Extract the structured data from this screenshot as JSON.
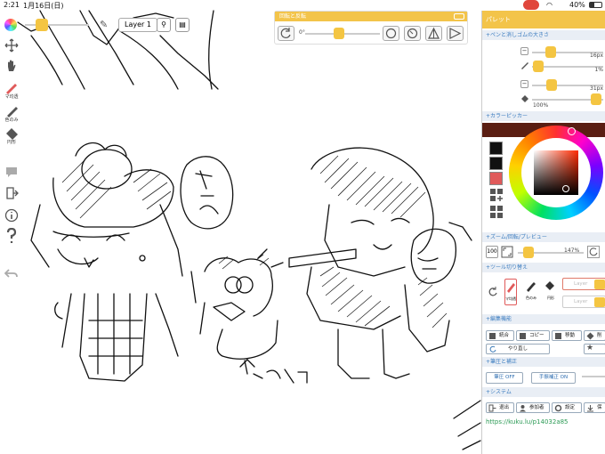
{
  "status": {
    "time": "2:21",
    "date": "1月16日(日)",
    "battery": "40%"
  },
  "layer": {
    "name": "Layer 1"
  },
  "left_toolbar": {
    "tools": [
      {
        "label": "マ均透"
      },
      {
        "label": "色のみ"
      },
      {
        "label": "円形"
      }
    ]
  },
  "rotate_panel": {
    "title": "回転と反転",
    "angle": "0°"
  },
  "palette": {
    "title": "パレット",
    "pen_size_section": "+ペンと消しゴムの大きさ",
    "pen_size_value": "16px",
    "pen_opacity_value": "1%",
    "eraser_size_value": "31px",
    "eraser_opacity_value": "100%",
    "color_picker_section": "+カラーピッカー",
    "zoom_section": "+ズーム/回転/プレビュー",
    "zoom_value": "100",
    "zoom_percent": "147%",
    "tool_switch_section": "+ツール切り替え",
    "tool_labels": [
      "マ均透",
      "色のみ",
      "円形"
    ],
    "layer_placeholder_1": "Layer",
    "layer_placeholder_2": "Layer",
    "edit_section": "+編集機能",
    "edit_buttons": [
      "統合",
      "コピー",
      "移動",
      "削"
    ],
    "redo_button": "やり直し",
    "stabilize_section": "+筆圧と補正",
    "pressure_button": "筆圧 OFF",
    "correction_button": "手振補正 ON",
    "system_section": "+システム",
    "system_buttons": [
      "退出",
      "参加者",
      "設定",
      "保"
    ],
    "link": "https://kuku.lu/p14032a85"
  },
  "colors": {
    "accent": "#f3c44a",
    "mic": "#e0463c",
    "swatch_black": "#111111",
    "swatch_red": "#e05a5a",
    "picked_color": "#5a1e12",
    "link": "#2b9a55"
  }
}
